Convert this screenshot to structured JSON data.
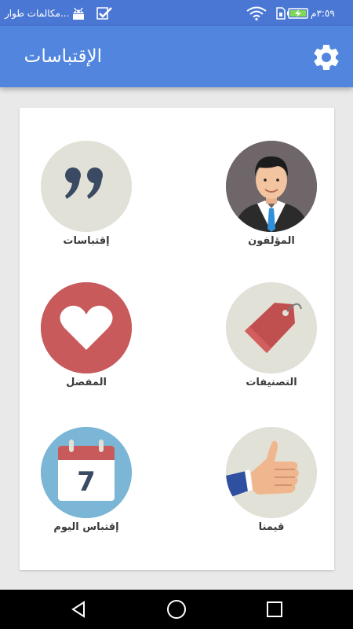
{
  "status_bar": {
    "time": "٣:٥٩م",
    "notification": "مكالمات طوار...",
    "icons": [
      "battery-charging-icon",
      "sim-icon",
      "wifi-icon",
      "check-icon",
      "android-debug-icon"
    ]
  },
  "app_bar": {
    "title": "الإقتباسات",
    "settings_icon": "gear-icon",
    "color": "#5286de"
  },
  "menu": [
    {
      "label": "المؤلفون",
      "icon": "author-avatar-icon"
    },
    {
      "label": "إقتباسات",
      "icon": "quote-marks-icon"
    },
    {
      "label": "التصنيفات",
      "icon": "tag-icon"
    },
    {
      "label": "المفضل",
      "icon": "heart-icon"
    },
    {
      "label": "قيمنا",
      "icon": "thumbs-up-icon"
    },
    {
      "label": "إقتباس اليوم",
      "icon": "calendar-icon",
      "calendar_day": "7"
    }
  ],
  "nav_bar": {
    "back_icon": "back-triangle-icon",
    "home_icon": "home-circle-icon",
    "recents_icon": "recents-square-icon"
  }
}
